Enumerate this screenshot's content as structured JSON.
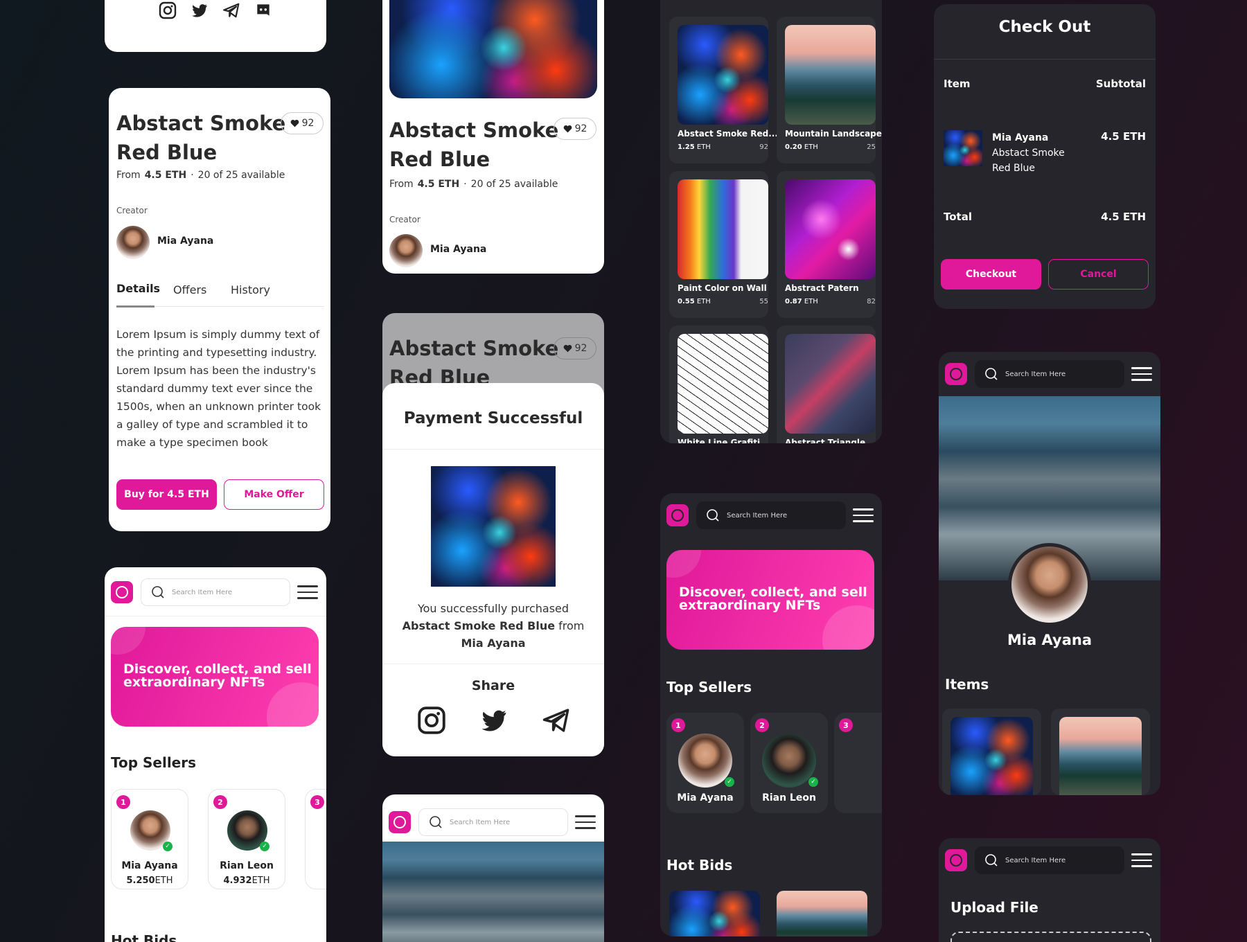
{
  "brand": {
    "accent": "#e0189a",
    "dark_bg": "#25252b",
    "light_bg": "#ffffff"
  },
  "icons": [
    "instagram-icon",
    "twitter-icon",
    "telegram-icon",
    "discord-icon",
    "heart-icon",
    "search-icon",
    "hamburger-icon",
    "check-icon"
  ],
  "detail": {
    "title_line1": "Abstact Smoke",
    "title_line2": "Red Blue",
    "likes": "92",
    "from_label": "From",
    "price": "4.5 ETH",
    "availability": "20 of 25 available",
    "creator_label": "Creator",
    "creator_name": "Mia Ayana",
    "tabs": [
      "Details",
      "Offers",
      "History"
    ],
    "description": [
      "Lorem Ipsum is simply dummy text of",
      "the printing and typesetting industry.",
      "Lorem Ipsum has been the industry's",
      "standard dummy text ever since the",
      "1500s, when an unknown printer took",
      "a galley of type and scrambled it to",
      "make a type specimen book"
    ],
    "buy_label": "Buy for 4.5 ETH",
    "offer_label": "Make Offer"
  },
  "home": {
    "search_placeholder": "Search Item Here",
    "hero_line1": "Discover, collect, and sell",
    "hero_line2": "extraordinary NFTs",
    "top_sellers": "Top Sellers",
    "hot_bids": "Hot Bids",
    "sellers": [
      {
        "rank": "1",
        "name": "Mia Ayana",
        "eth": "5.250",
        "unit": "ETH"
      },
      {
        "rank": "2",
        "name": "Rian Leon",
        "eth": "4.932",
        "unit": "ETH"
      },
      {
        "rank": "3",
        "name": "",
        "eth": "",
        "unit": ""
      }
    ]
  },
  "payment": {
    "title": "Payment Successful",
    "line1": "You successfully purchased",
    "item": "Abstact Smoke Red Blue",
    "from": "from",
    "seller": "Mia Ayana",
    "share": "Share"
  },
  "grid": [
    {
      "name": "Abstact Smoke Red...",
      "price": "1.25",
      "unit": "ETH",
      "likes": "92"
    },
    {
      "name": "Mountain Landscape",
      "price": "0.20",
      "unit": "ETH",
      "likes": "25"
    },
    {
      "name": "Paint Color on Wall",
      "price": "0.55",
      "unit": "ETH",
      "likes": "55"
    },
    {
      "name": "Abstract Patern",
      "price": "0.87",
      "unit": "ETH",
      "likes": "82"
    },
    {
      "name": "White Line Grafiti",
      "price": "",
      "unit": "",
      "likes": ""
    },
    {
      "name": "Abstract Triangle",
      "price": "",
      "unit": "",
      "likes": ""
    }
  ],
  "checkout": {
    "title": "Check Out",
    "item_header": "Item",
    "subtotal_header": "Subtotal",
    "creator": "Mia Ayana",
    "item_line1": "Abstact Smoke",
    "item_line2": "Red Blue",
    "item_price": "4.5 ETH",
    "total_label": "Total",
    "total_value": "4.5 ETH",
    "checkout_label": "Checkout",
    "cancel_label": "Cancel"
  },
  "profile": {
    "name": "Mia Ayana",
    "items_label": "Items"
  },
  "upload": {
    "title": "Upload File"
  }
}
